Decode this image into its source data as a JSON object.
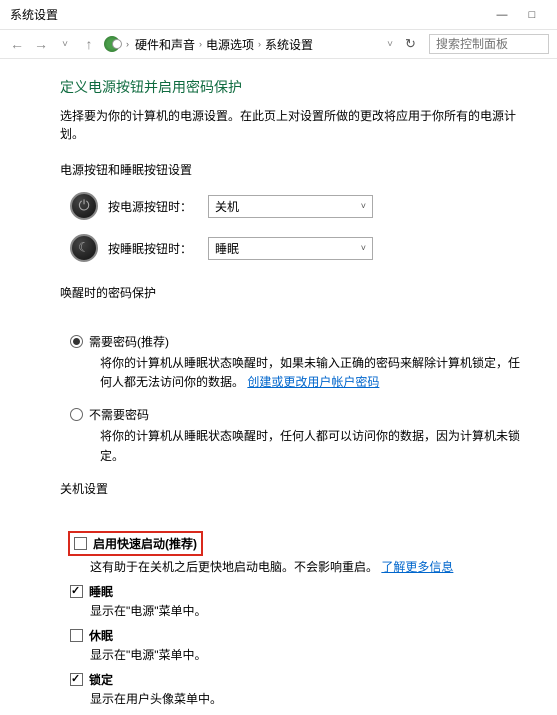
{
  "titlebar": {
    "title": "系统设置",
    "minimize": "—",
    "maximize": "□"
  },
  "nav": {
    "back": "←",
    "forward": "→",
    "up": "˅",
    "home": "↑",
    "refresh": "↻",
    "breadcrumb": [
      "硬件和声音",
      "电源选项",
      "系统设置"
    ],
    "search_placeholder": "搜索控制面板",
    "dropdown_hint": "˅"
  },
  "page": {
    "title": "定义电源按钮并启用密码保护",
    "desc": "选择要为你的计算机的电源设置。在此页上对设置所做的更改将应用于你所有的电源计划。"
  },
  "section1": {
    "header": "电源按钮和睡眠按钮设置",
    "power_label": "按电源按钮时：",
    "power_value": "关机",
    "sleep_label": "按睡眠按钮时：",
    "sleep_value": "睡眠"
  },
  "section2": {
    "header": "唤醒时的密码保护",
    "opt1_label": "需要密码(推荐)",
    "opt1_desc_a": "将你的计算机从睡眠状态唤醒时，如果未输入正确的密码来解除计算机锁定，任何人都无法访问你的数据。",
    "opt1_link": "创建或更改用户帐户密码",
    "opt2_label": "不需要密码",
    "opt2_desc": "将你的计算机从睡眠状态唤醒时，任何人都可以访问你的数据，因为计算机未锁定。"
  },
  "section3": {
    "header": "关机设置",
    "fast_label": "启用快速启动(推荐)",
    "fast_desc_a": "这有助于在关机之后更快地启动电脑。不会影响重启。",
    "fast_link": "了解更多信息",
    "sleep_label": "睡眠",
    "sleep_desc": "显示在\"电源\"菜单中。",
    "hibernate_label": "休眠",
    "hibernate_desc": "显示在\"电源\"菜单中。",
    "lock_label": "锁定",
    "lock_desc": "显示在用户头像菜单中。"
  }
}
